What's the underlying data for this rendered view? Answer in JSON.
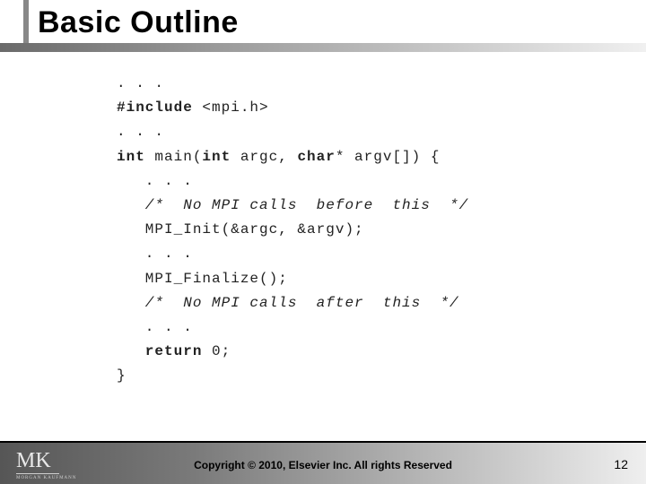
{
  "title": "Basic Outline",
  "code": {
    "l1": ". . .",
    "l2a": "#include ",
    "l2b": "<mpi.h>",
    "l3": ". . .",
    "l4a": "int ",
    "l4b": "main(",
    "l4c": "int ",
    "l4d": "argc, ",
    "l4e": "char",
    "l4f": "* argv[]) {",
    "l5": "   . . .",
    "l6": "   /*  No MPI calls  before  this  */",
    "l7": "   MPI_Init(&argc, &argv);",
    "l8": "   . . .",
    "l9": "   MPI_Finalize();",
    "l10": "   /*  No MPI calls  after  this  */",
    "l11": "   . . .",
    "l12a": "   return ",
    "l12b": "0;",
    "l13": "}"
  },
  "footer": {
    "copyright": "Copyright © 2010, Elsevier Inc. All rights Reserved",
    "page": "12",
    "logo_main": "MK",
    "logo_sub": "MORGAN KAUFMANN"
  }
}
